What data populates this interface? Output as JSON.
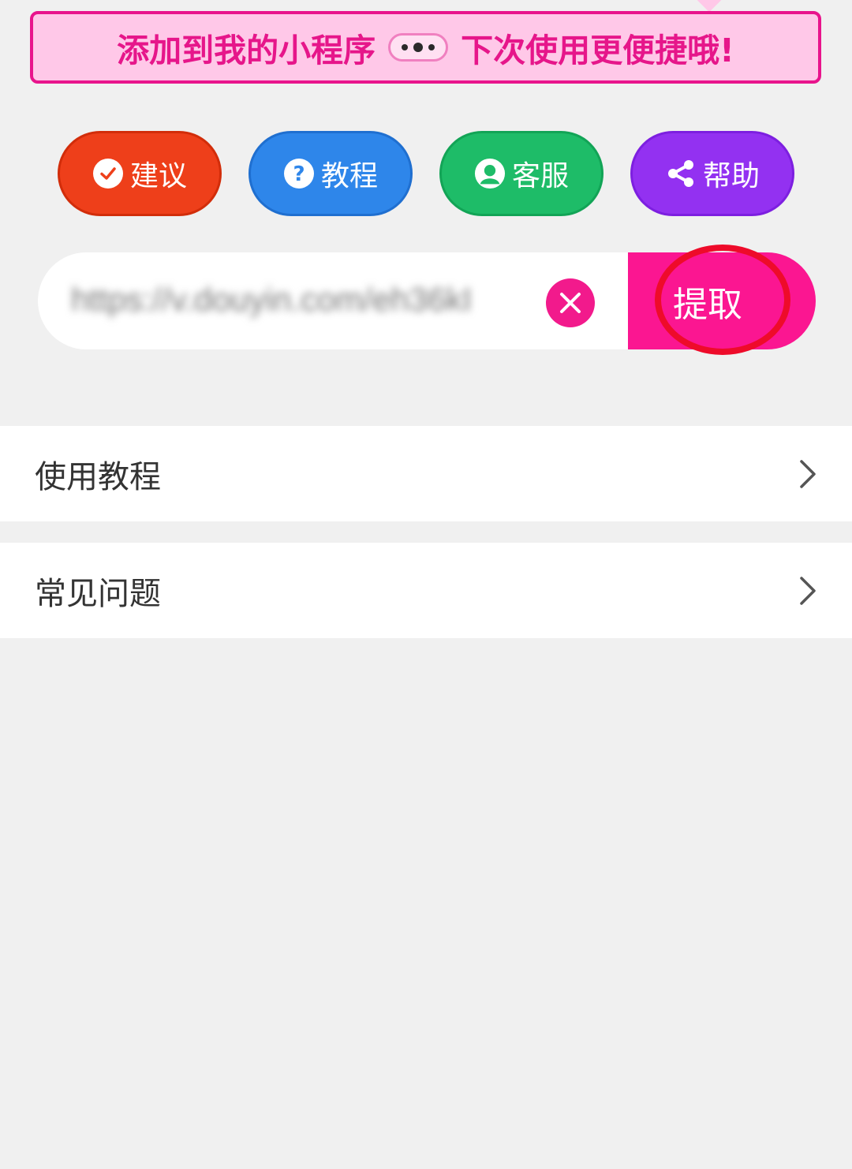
{
  "banner": {
    "text_before": "添加到我的小程序",
    "text_after": "下次使用更便捷哦!",
    "menu_icon": "more-dots-icon"
  },
  "actions": [
    {
      "label": "建议",
      "icon": "check-circle-icon",
      "color": "#ee3f1a"
    },
    {
      "label": "教程",
      "icon": "question-circle-icon",
      "color": "#2e86ea"
    },
    {
      "label": "客服",
      "icon": "user-circle-icon",
      "color": "#1ebc68"
    },
    {
      "label": "帮助",
      "icon": "share-icon",
      "color": "#9331f1"
    }
  ],
  "url_input": {
    "value": "https://v.douyin.com/eh36kI",
    "clear_icon": "close-icon"
  },
  "extract_button": {
    "label": "提取",
    "color": "#fb1691"
  },
  "list": [
    {
      "label": "使用教程",
      "icon": "chevron-right-icon"
    },
    {
      "label": "常见问题",
      "icon": "chevron-right-icon"
    }
  ]
}
